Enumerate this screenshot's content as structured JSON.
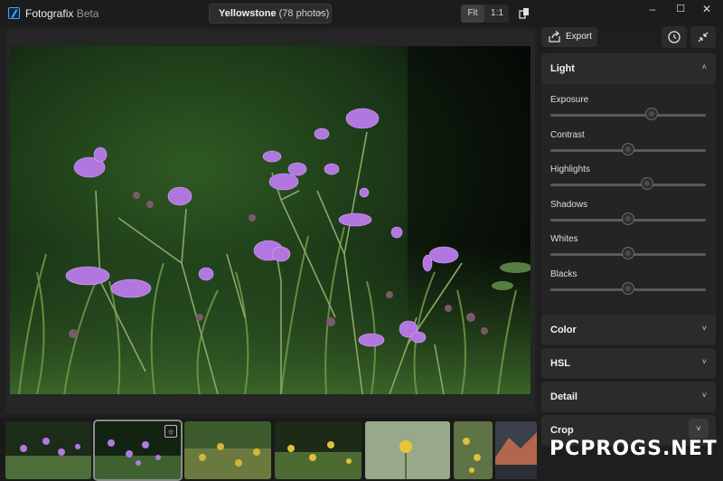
{
  "app": {
    "name": "Fotografix",
    "tag": "Beta"
  },
  "album": {
    "name": "Yellowstone",
    "count_text": "(78 photos)"
  },
  "zoom": {
    "fit_label": "Fit",
    "actual_label": "1:1",
    "active": "fit"
  },
  "window": {
    "minimize": "–",
    "maximize": "☐",
    "close": "✕"
  },
  "panel": {
    "export_label": "Export",
    "sections": {
      "light": "Light",
      "color": "Color",
      "hsl": "HSL",
      "detail": "Detail",
      "crop": "Crop"
    },
    "sliders": [
      {
        "label": "Exposure",
        "value": 0.65
      },
      {
        "label": "Contrast",
        "value": 0.5
      },
      {
        "label": "Highlights",
        "value": 0.62
      },
      {
        "label": "Shadows",
        "value": 0.5
      },
      {
        "label": "Whites",
        "value": 0.5
      },
      {
        "label": "Blacks",
        "value": 0.5
      }
    ]
  },
  "filmstrip": {
    "selected_index": 1,
    "badge_icon": "edit-badge-icon"
  },
  "colors": {
    "accent": "#4aa3ff",
    "flower": "#b06cdb"
  },
  "watermark": "PCPROGS.NET"
}
